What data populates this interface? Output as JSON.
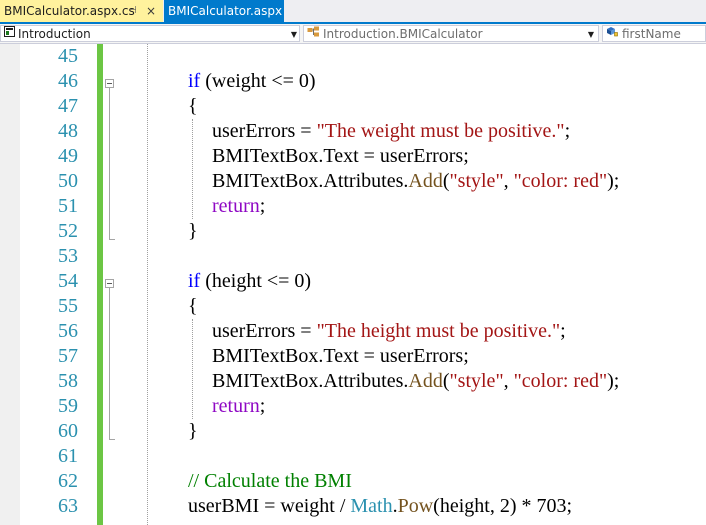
{
  "tabs": [
    {
      "label": "BMICalculator.aspx.cs",
      "active": true
    },
    {
      "label": "BMICalculator.aspx",
      "active": false
    }
  ],
  "tab_pin_glyph": "⊣",
  "tab_close_glyph": "×",
  "navbar": {
    "project": "Introduction",
    "class": "Introduction.BMICalculator",
    "member": "firstName"
  },
  "line_numbers": [
    "45",
    "46",
    "47",
    "48",
    "49",
    "50",
    "51",
    "52",
    "53",
    "54",
    "55",
    "56",
    "57",
    "58",
    "59",
    "60",
    "61",
    "62",
    "63"
  ],
  "code_lines": [
    {
      "indent": 0,
      "tokens": []
    },
    {
      "indent": 1,
      "tokens": [
        {
          "t": "if",
          "c": "kw"
        },
        {
          "t": " (weight <= 0)",
          "c": ""
        }
      ]
    },
    {
      "indent": 1,
      "tokens": [
        {
          "t": "{",
          "c": ""
        }
      ]
    },
    {
      "indent": 2,
      "tokens": [
        {
          "t": "userErrors = ",
          "c": ""
        },
        {
          "t": "\"The weight must be positive.\"",
          "c": "str"
        },
        {
          "t": ";",
          "c": ""
        }
      ]
    },
    {
      "indent": 2,
      "tokens": [
        {
          "t": "BMITextBox.Text = userErrors;",
          "c": ""
        }
      ]
    },
    {
      "indent": 2,
      "tokens": [
        {
          "t": "BMITextBox.Attributes.",
          "c": ""
        },
        {
          "t": "Add",
          "c": "mt"
        },
        {
          "t": "(",
          "c": ""
        },
        {
          "t": "\"style\"",
          "c": "str"
        },
        {
          "t": ", ",
          "c": ""
        },
        {
          "t": "\"color: red\"",
          "c": "str"
        },
        {
          "t": ");",
          "c": ""
        }
      ]
    },
    {
      "indent": 2,
      "tokens": [
        {
          "t": "return",
          "c": "kw2"
        },
        {
          "t": ";",
          "c": ""
        }
      ]
    },
    {
      "indent": 1,
      "tokens": [
        {
          "t": "}",
          "c": ""
        }
      ]
    },
    {
      "indent": 0,
      "tokens": []
    },
    {
      "indent": 1,
      "tokens": [
        {
          "t": "if",
          "c": "kw"
        },
        {
          "t": " (height <= 0)",
          "c": ""
        }
      ]
    },
    {
      "indent": 1,
      "tokens": [
        {
          "t": "{",
          "c": ""
        }
      ]
    },
    {
      "indent": 2,
      "tokens": [
        {
          "t": "userErrors = ",
          "c": ""
        },
        {
          "t": "\"The height must be positive.\"",
          "c": "str"
        },
        {
          "t": ";",
          "c": ""
        }
      ]
    },
    {
      "indent": 2,
      "tokens": [
        {
          "t": "BMITextBox.Text = userErrors;",
          "c": ""
        }
      ]
    },
    {
      "indent": 2,
      "tokens": [
        {
          "t": "BMITextBox.Attributes.",
          "c": ""
        },
        {
          "t": "Add",
          "c": "mt"
        },
        {
          "t": "(",
          "c": ""
        },
        {
          "t": "\"style\"",
          "c": "str"
        },
        {
          "t": ", ",
          "c": ""
        },
        {
          "t": "\"color: red\"",
          "c": "str"
        },
        {
          "t": ");",
          "c": ""
        }
      ]
    },
    {
      "indent": 2,
      "tokens": [
        {
          "t": "return",
          "c": "kw2"
        },
        {
          "t": ";",
          "c": ""
        }
      ]
    },
    {
      "indent": 1,
      "tokens": [
        {
          "t": "}",
          "c": ""
        }
      ]
    },
    {
      "indent": 0,
      "tokens": []
    },
    {
      "indent": 1,
      "tokens": [
        {
          "t": "// Calculate the BMI",
          "c": "cm"
        }
      ]
    },
    {
      "indent": 1,
      "tokens": [
        {
          "t": "userBMI = weight / ",
          "c": ""
        },
        {
          "t": "Math",
          "c": "ty"
        },
        {
          "t": ".",
          "c": ""
        },
        {
          "t": "Pow",
          "c": "mt"
        },
        {
          "t": "(height, 2) * 703;",
          "c": ""
        }
      ]
    }
  ],
  "colors": {
    "keyword": "#0000ff",
    "control_keyword": "#8f08c4",
    "string": "#a31515",
    "comment": "#008000",
    "type": "#2b91af",
    "method": "#74531f",
    "line_number": "#2b91af",
    "change_bar": "#6cc644",
    "active_tab": "#fff29d",
    "inactive_tab": "#007acc"
  }
}
